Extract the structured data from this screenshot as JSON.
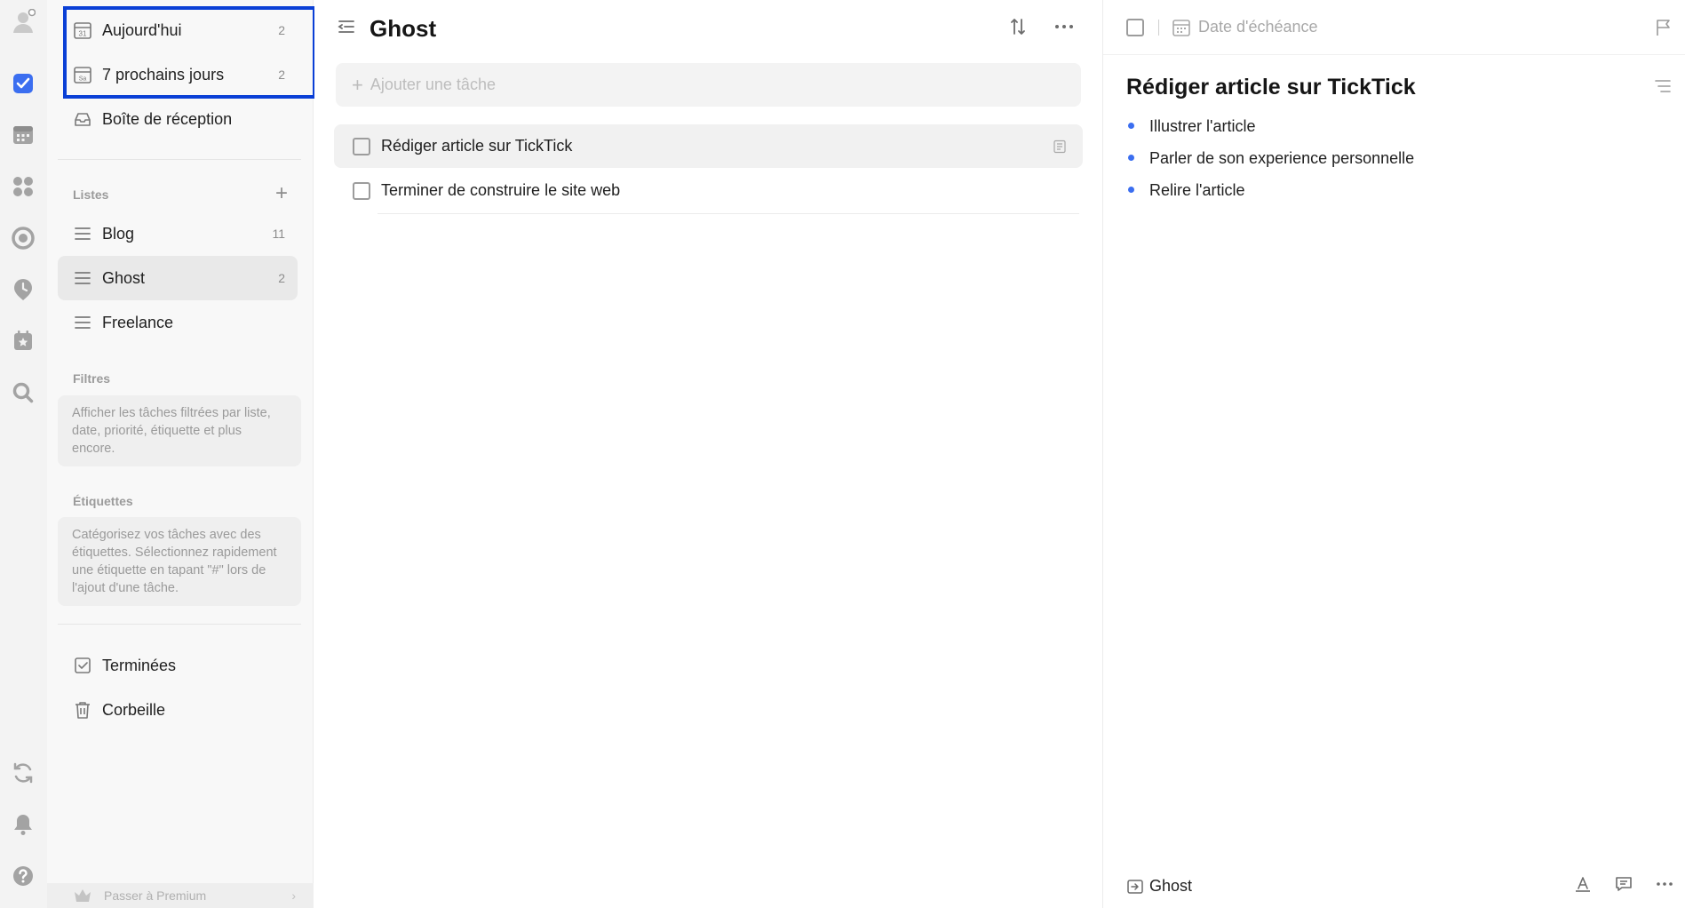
{
  "nav": {
    "today": {
      "label": "Aujourd'hui",
      "count": "2"
    },
    "next7": {
      "label": "7 prochains jours",
      "count": "2"
    },
    "inbox": {
      "label": "Boîte de réception"
    }
  },
  "lists": {
    "section_label": "Listes",
    "items": [
      {
        "label": "Blog",
        "count": "11"
      },
      {
        "label": "Ghost",
        "count": "2"
      },
      {
        "label": "Freelance",
        "count": ""
      }
    ]
  },
  "filters": {
    "section_label": "Filtres",
    "hint": "Afficher les tâches filtrées par liste, date, priorité, étiquette et plus encore."
  },
  "tags": {
    "section_label": "Étiquettes",
    "hint": "Catégorisez vos tâches avec des étiquettes. Sélectionnez rapidement une étiquette en tapant \"#\" lors de l'ajout d'une tâche."
  },
  "bottom_nav": {
    "completed": "Terminées",
    "trash": "Corbeille"
  },
  "premium": {
    "label": "Passer à Premium"
  },
  "main": {
    "title": "Ghost",
    "add_placeholder": "Ajouter une tâche",
    "tasks": [
      {
        "title": "Rédiger article sur TickTick"
      },
      {
        "title": "Terminer de construire le site web"
      }
    ]
  },
  "detail": {
    "due_placeholder": "Date d'échéance",
    "title": "Rédiger article sur TickTick",
    "bullets": [
      "Illustrer l'article",
      "Parler de son experience personnelle",
      "Relire l'article"
    ],
    "list_name": "Ghost"
  },
  "colors": {
    "accent": "#3b6ef0",
    "highlight": "#0a3fd6"
  }
}
